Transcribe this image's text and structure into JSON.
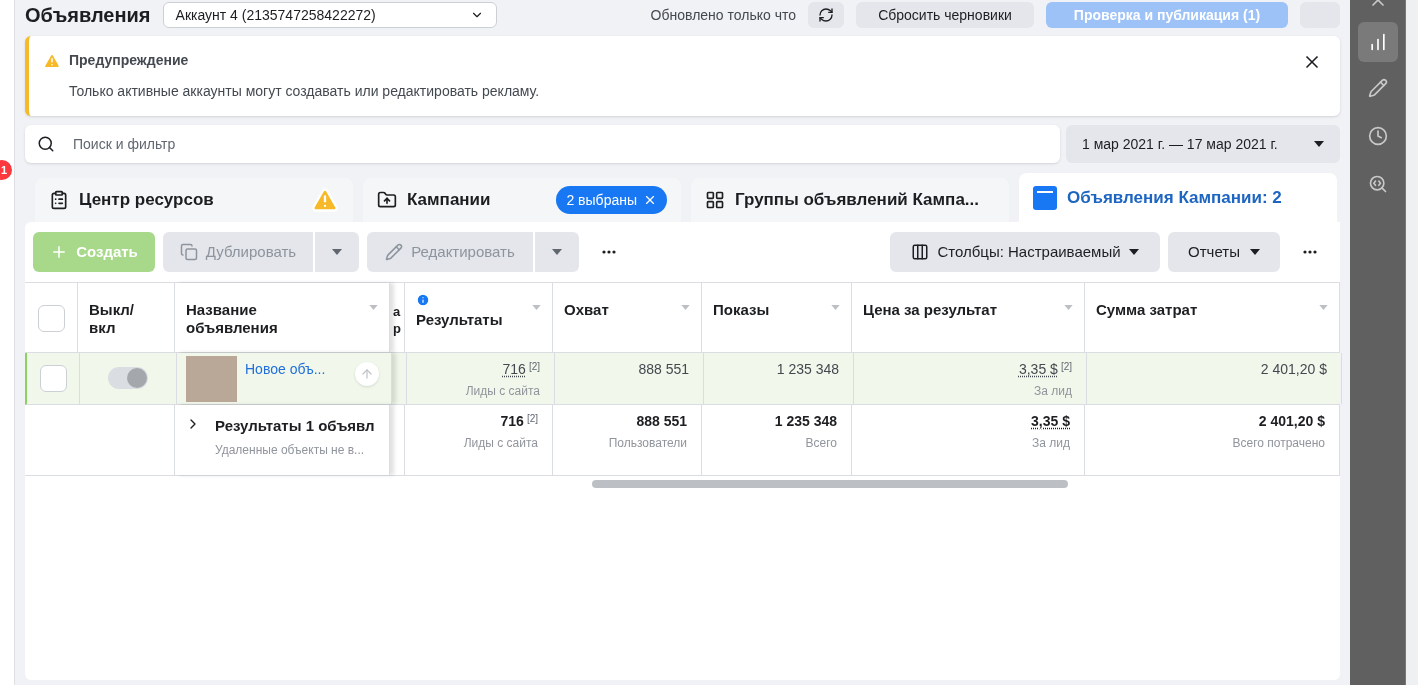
{
  "top_bar": {
    "title": "Объявления",
    "account": "Аккаунт 4 (2135747258422272)",
    "status": "Обновлено только что",
    "buttons": [
      {
        "label": "Сбросить черновики",
        "kind": "secondary"
      },
      {
        "label": "Проверка и публикация (1)",
        "kind": "primary"
      }
    ]
  },
  "left_strip": {
    "badge": "1"
  },
  "alert": {
    "title": "Предупреждение",
    "message": "Только активные аккаунты могут создавать или редактировать рекламу."
  },
  "search": {
    "placeholder": "Поиск и фильтр"
  },
  "date_range": "1 мар 2021 г. — 17 мар 2021 г.",
  "tabs": [
    {
      "label": "Центр ресурсов",
      "kind": "resources",
      "selected": false,
      "warning": true
    },
    {
      "label": "Кампании",
      "kind": "campaigns",
      "selected": false,
      "chip": "2 выбраны"
    },
    {
      "label": "Группы объявлений Кампа...",
      "kind": "adsets",
      "selected": false
    },
    {
      "label": "Объявления Кампании: 2",
      "kind": "ads",
      "selected": true
    }
  ],
  "toolbar": {
    "create": {
      "label": "Создать",
      "disabled": true
    },
    "duplicate": {
      "label": "Дублировать",
      "disabled": true
    },
    "edit": {
      "label": "Редактировать",
      "disabled": true
    },
    "columns": "Столбцы: Настраиваемый",
    "reports": "Отчеты"
  },
  "table": {
    "header_checked": false,
    "columns": [
      {
        "label": "Выкл/ вкл"
      },
      {
        "label": "Название объявления"
      },
      {
        "fragment": [
          "а",
          "р"
        ]
      },
      {
        "label": "Результаты",
        "info": true
      },
      {
        "label": "Охват"
      },
      {
        "label": "Показы"
      },
      {
        "label": "Цена за результат"
      },
      {
        "label": "Сумма затрат"
      }
    ],
    "rows": [
      {
        "checked": false,
        "highlighted": true,
        "toggle": {
          "on": true,
          "disabled": true
        },
        "name": "Новое объ...",
        "cells": [
          {
            "value": "716",
            "note": "[2]",
            "sub": "Лиды с сайта",
            "dotted": true
          },
          {
            "value": "888 551"
          },
          {
            "value": "1 235 348"
          },
          {
            "value": "3,35 $",
            "note": "[2]",
            "sub": "За лид",
            "dotted": true
          },
          {
            "value": "2 401,20 $"
          }
        ]
      }
    ],
    "summary": {
      "title": "Результаты 1 объявл",
      "subtitle": "Удаленные объекты не в...",
      "cells": [
        {
          "value": "716",
          "note": "[2]",
          "sub": "Лиды с сайта"
        },
        {
          "value": "888 551",
          "sub": "Пользователи"
        },
        {
          "value": "1 235 348",
          "sub": "Всего"
        },
        {
          "value": "3,35 $",
          "sub": "За лид",
          "dotted": true
        },
        {
          "value": "2 401,20 $",
          "sub": "Всего потрачено"
        }
      ]
    }
  }
}
